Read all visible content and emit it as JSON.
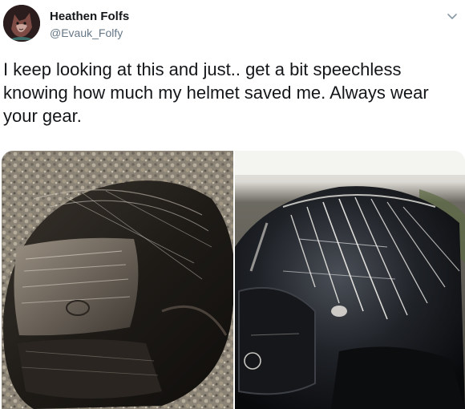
{
  "author": {
    "name": "Heathen Folfs",
    "handle": "@Evauk_Folfy",
    "avatar_icon": "wolf-avatar-icon"
  },
  "menu": {
    "icon": "chevron-down-icon"
  },
  "tweet": {
    "text": "I keep looking at this and just.. get a bit speechless knowing how much my helmet saved me. Always wear your gear."
  },
  "media": {
    "count": 2
  },
  "colors": {
    "text": "#14171a",
    "secondary": "#657786"
  }
}
